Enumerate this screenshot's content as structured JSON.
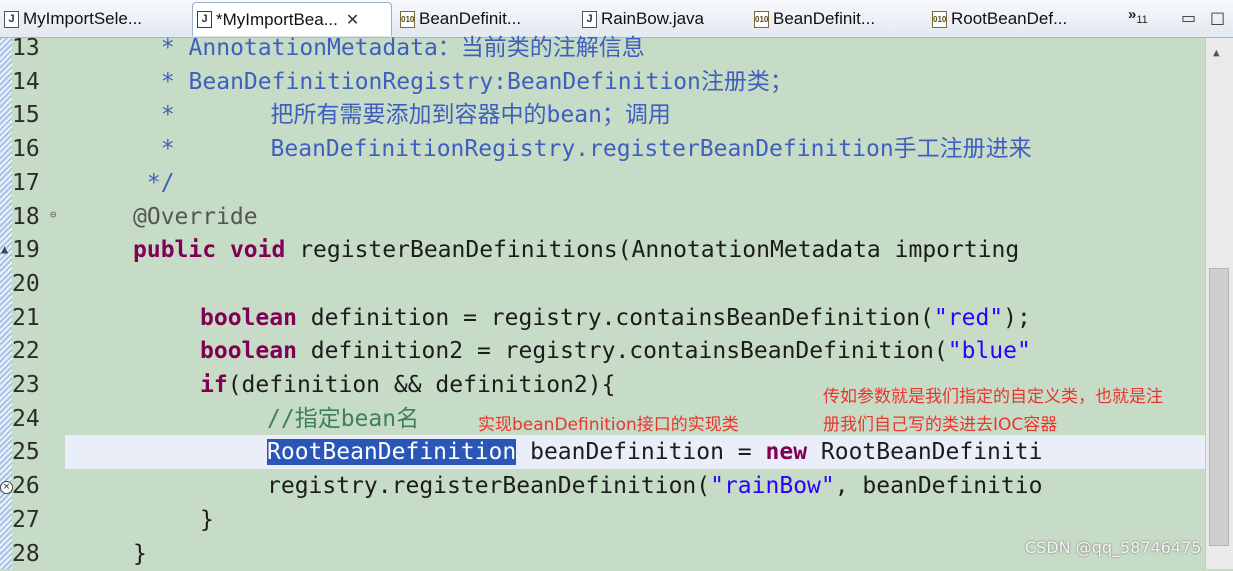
{
  "tabs": [
    {
      "label": "MyImportSele...",
      "icon": "java-file-icon"
    },
    {
      "label": "*MyImportBea...",
      "icon": "java-file-error-icon",
      "active": true
    },
    {
      "label": "BeanDefinit...",
      "icon": "class-file-icon"
    },
    {
      "label": "RainBow.java",
      "icon": "java-file-icon"
    },
    {
      "label": "BeanDefinit...",
      "icon": "class-file-icon"
    },
    {
      "label": "RootBeanDef...",
      "icon": "class-file-icon"
    }
  ],
  "tab_overflow": {
    "symbol": "»",
    "count": "11"
  },
  "lines": [
    {
      "num": "13"
    },
    {
      "num": "14"
    },
    {
      "num": "15"
    },
    {
      "num": "16"
    },
    {
      "num": "17"
    },
    {
      "num": "18"
    },
    {
      "num": "19"
    },
    {
      "num": "20"
    },
    {
      "num": "21"
    },
    {
      "num": "22"
    },
    {
      "num": "23"
    },
    {
      "num": "24"
    },
    {
      "num": "25"
    },
    {
      "num": "26"
    },
    {
      "num": "27"
    },
    {
      "num": "28"
    }
  ],
  "code": {
    "l13": {
      "star": " * ",
      "text": "AnnotationMetadata：当前类的注解信息"
    },
    "l14": {
      "star": " * ",
      "text": "BeanDefinitionRegistry:BeanDefinition注册类；"
    },
    "l15": {
      "star": " * ",
      "text": "把所有需要添加到容器中的bean；调用"
    },
    "l16": {
      "star": " * ",
      "text": "BeanDefinitionRegistry.registerBeanDefinition手工注册进来"
    },
    "l17": {
      "text": " */"
    },
    "l18": {
      "text": "@Override"
    },
    "l19": {
      "kw1": "public",
      "kw2": "void",
      "rest": " registerBeanDefinitions(AnnotationMetadata importing"
    },
    "l21": {
      "kw": "boolean",
      "rest": " definition = registry.containsBeanDefinition(",
      "str": "\"red\"",
      "tail": ");"
    },
    "l22": {
      "kw": "boolean",
      "rest": " definition2 = registry.containsBeanDefinition(",
      "str": "\"blue\""
    },
    "l23": {
      "kw": "if",
      "rest": "(definition && definition2){"
    },
    "l24": {
      "text": "//指定bean名"
    },
    "l25": {
      "sel": "RootBeanDefinition",
      "rest": " beanDefinition = ",
      "kw": "new",
      "tail": " RootBeanDefiniti"
    },
    "l26": {
      "rest": "registry.registerBeanDefinition(",
      "str": "\"rainBow\"",
      "tail": ", beanDefinitio"
    },
    "l27": {
      "text": "}"
    },
    "l28": {
      "text": "}"
    }
  },
  "annotations": {
    "impl_note": "实现beanDefinition接口的实现类",
    "param_note_1": "传如参数就是我们指定的自定义类，也就是注",
    "param_note_2": "册我们自己写的类进去IOC容器"
  },
  "watermark": "CSDN @qq_58746475",
  "colors": {
    "editor_bg": "#c7dcc6",
    "keyword": "#7f0055",
    "string": "#2a00ff",
    "selection": "#2a56b8",
    "note_red": "#e8352e"
  }
}
